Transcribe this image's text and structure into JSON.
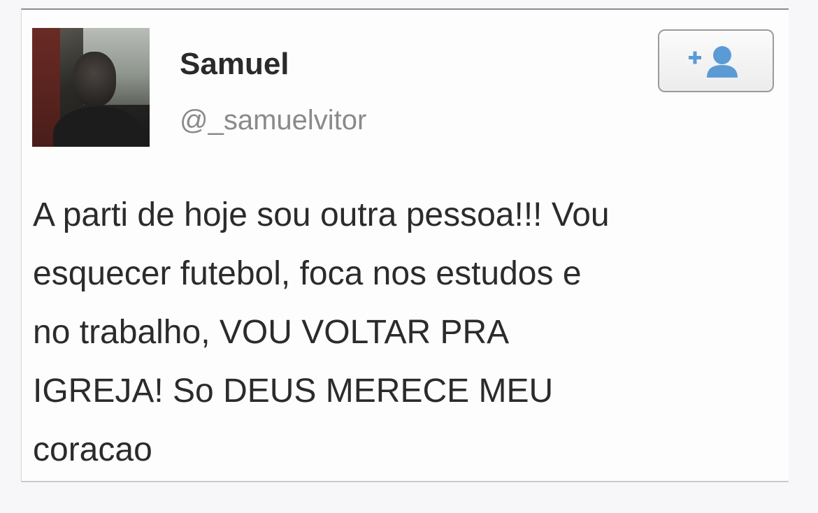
{
  "tweet": {
    "user_name": "Samuel",
    "user_handle": "@_samuelvitor",
    "text": "A parti de hoje sou outra pessoa!!! Vou\nesquecer futebol, foca nos estudos e\nno trabalho, VOU VOLTAR PRA\nIGREJA! So DEUS MERECE MEU\ncoracao",
    "follow_icon": "add-user-icon",
    "avatar_icon": "user-photo"
  },
  "colors": {
    "name": "#2a2a2a",
    "handle": "#8a8a8a",
    "follow_icon": "#5b9bd5",
    "text": "#2b2b2b"
  }
}
